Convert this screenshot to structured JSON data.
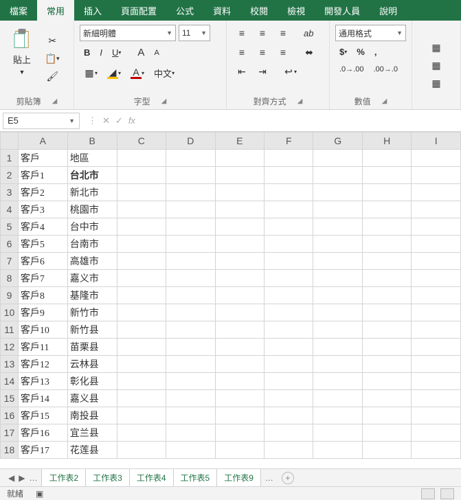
{
  "tabs": [
    "檔案",
    "常用",
    "插入",
    "頁面配置",
    "公式",
    "資料",
    "校閱",
    "檢視",
    "開發人員",
    "說明"
  ],
  "active_tab": 1,
  "ribbon": {
    "clipboard": {
      "paste": "貼上",
      "label": "剪貼簿"
    },
    "font": {
      "name": "新細明體",
      "size": "11",
      "label": "字型"
    },
    "align": {
      "label": "對齊方式"
    },
    "number": {
      "format": "通用格式",
      "label": "數值"
    }
  },
  "namebox": "E5",
  "fx": "fx",
  "cols": [
    "A",
    "B",
    "C",
    "D",
    "E",
    "F",
    "G",
    "H",
    "I"
  ],
  "rows": [
    {
      "n": 1,
      "a": "客戶",
      "b": "地區"
    },
    {
      "n": 2,
      "a": "客戶1",
      "b": "台北市",
      "bold": true
    },
    {
      "n": 3,
      "a": "客戶2",
      "b": "新北市"
    },
    {
      "n": 4,
      "a": "客戶3",
      "b": "桃園市"
    },
    {
      "n": 5,
      "a": "客戶4",
      "b": "台中市"
    },
    {
      "n": 6,
      "a": "客戶5",
      "b": "台南市"
    },
    {
      "n": 7,
      "a": "客戶6",
      "b": "高雄市"
    },
    {
      "n": 8,
      "a": "客戶7",
      "b": "嘉义市"
    },
    {
      "n": 9,
      "a": "客戶8",
      "b": "基隆市"
    },
    {
      "n": 10,
      "a": "客戶9",
      "b": "新竹市"
    },
    {
      "n": 11,
      "a": "客戶10",
      "b": "新竹县"
    },
    {
      "n": 12,
      "a": "客戶11",
      "b": "苗栗县"
    },
    {
      "n": 13,
      "a": "客戶12",
      "b": "云林县"
    },
    {
      "n": 14,
      "a": "客戶13",
      "b": "彰化县"
    },
    {
      "n": 15,
      "a": "客戶14",
      "b": "嘉义县"
    },
    {
      "n": 16,
      "a": "客戶15",
      "b": "南投县"
    },
    {
      "n": 17,
      "a": "客戶16",
      "b": "宜兰县"
    },
    {
      "n": 18,
      "a": "客戶17",
      "b": "花莲县"
    }
  ],
  "sheets": [
    "工作表2",
    "工作表3",
    "工作表4",
    "工作表5",
    "工作表9"
  ],
  "status": "就緒"
}
